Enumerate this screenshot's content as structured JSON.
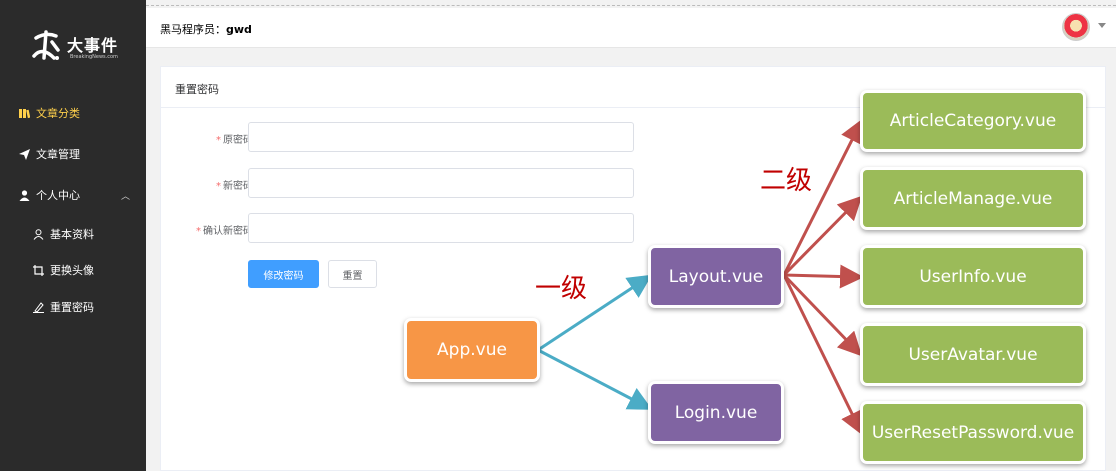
{
  "sidebar": {
    "logo_text": "大事件",
    "logo_sub": "BreakingNews.com",
    "items": [
      {
        "label": "文章分类",
        "active": true,
        "icon": "book-icon"
      },
      {
        "label": "文章管理",
        "icon": "paper-plane-icon"
      },
      {
        "label": "个人中心",
        "icon": "user-icon",
        "expanded": true
      },
      {
        "label": "基本资料",
        "icon": "user-outline-icon"
      },
      {
        "label": "更换头像",
        "icon": "crop-icon"
      },
      {
        "label": "重置密码",
        "icon": "edit-icon"
      }
    ],
    "active_color": "#ffd04b"
  },
  "header": {
    "welcome_label": "黑马程序员：",
    "username": "gwd"
  },
  "card": {
    "title": "重置密码",
    "fields": [
      {
        "label": "原密码",
        "value": ""
      },
      {
        "label": "新密码",
        "value": ""
      },
      {
        "label": "确认新密码",
        "value": ""
      }
    ],
    "submit_label": "修改密码",
    "reset_label": "重置"
  },
  "diagram": {
    "root": "App.vue",
    "level1": [
      "Layout.vue",
      "Login.vue"
    ],
    "level2": [
      "ArticleCategory.vue",
      "ArticleManage.vue",
      "UserInfo.vue",
      "UserAvatar.vue",
      "UserResetPassword.vue"
    ],
    "level1_label": "一级",
    "level2_label": "二级",
    "colors": {
      "root": "#f79646",
      "level1": "#8064a2",
      "level2": "#9bbb59",
      "arrow1": "#4bacc6",
      "arrow2": "#c0504d",
      "level_text": "#c00000"
    }
  }
}
